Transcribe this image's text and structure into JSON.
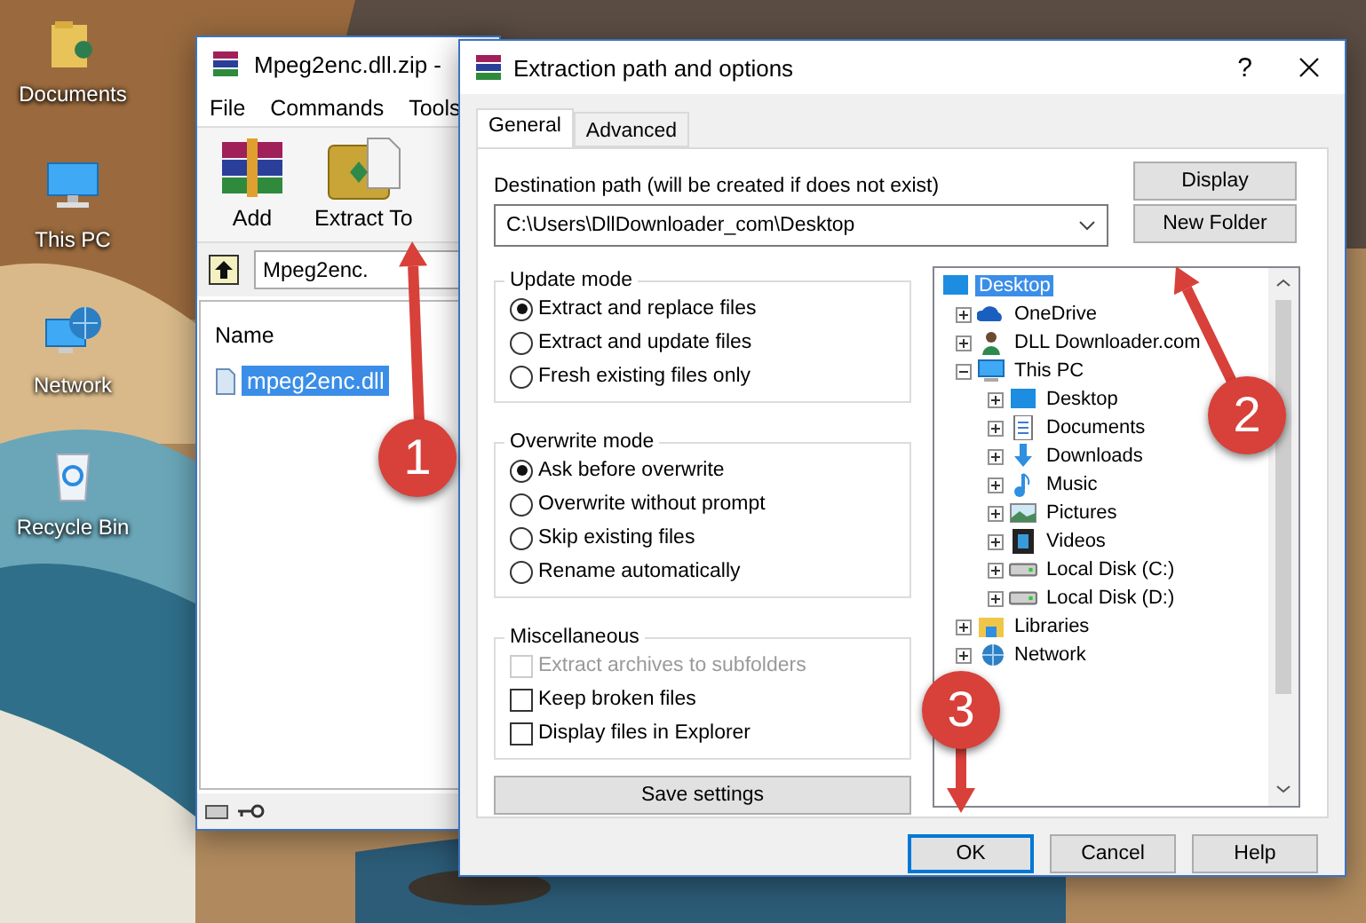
{
  "desktop_icons": [
    {
      "label": "Documents",
      "kind": "folder"
    },
    {
      "label": "This PC",
      "kind": "computer"
    },
    {
      "label": "Network",
      "kind": "network"
    },
    {
      "label": "Recycle Bin",
      "kind": "bin"
    }
  ],
  "archiver": {
    "title": "Mpeg2enc.dll.zip -",
    "menu": [
      "File",
      "Commands",
      "Tools"
    ],
    "toolbar": [
      {
        "label": "Add",
        "kind": "add"
      },
      {
        "label": "Extract To",
        "kind": "extract"
      }
    ],
    "path": "Mpeg2enc.",
    "column": "Name",
    "files": [
      {
        "name": "mpeg2enc.dll",
        "selected": true
      }
    ]
  },
  "dialog": {
    "title": "Extraction path and options",
    "help": "?",
    "tabs": [
      {
        "label": "General",
        "selected": true
      },
      {
        "label": "Advanced",
        "selected": false
      }
    ],
    "destination": {
      "label": "Destination path (will be created if does not exist)",
      "value": "C:\\Users\\DllDownloader_com\\Desktop"
    },
    "side_buttons": [
      "Display",
      "New Folder"
    ],
    "groups": [
      {
        "title": "Update mode",
        "kind": "radio",
        "options": [
          {
            "label": "Extract and replace files",
            "selected": true
          },
          {
            "label": "Extract and update files",
            "selected": false
          },
          {
            "label": "Fresh existing files only",
            "selected": false
          }
        ]
      },
      {
        "title": "Overwrite mode",
        "kind": "radio",
        "options": [
          {
            "label": "Ask before overwrite",
            "selected": true
          },
          {
            "label": "Overwrite without prompt",
            "selected": false
          },
          {
            "label": "Skip existing files",
            "selected": false
          },
          {
            "label": "Rename automatically",
            "selected": false
          }
        ]
      },
      {
        "title": "Miscellaneous",
        "kind": "check",
        "options": [
          {
            "label": "Extract archives to subfolders",
            "checked": false,
            "disabled": true
          },
          {
            "label": "Keep broken files",
            "checked": false,
            "disabled": false
          },
          {
            "label": "Display files in Explorer",
            "checked": false,
            "disabled": false
          }
        ]
      }
    ],
    "save_button": "Save settings",
    "tree": [
      {
        "label": "Desktop",
        "kind": "desktop",
        "selected": true,
        "children": [
          {
            "label": "OneDrive",
            "kind": "cloud",
            "selected": false,
            "expanded": false
          },
          {
            "label": "DLL Downloader.com",
            "kind": "user",
            "selected": false,
            "expanded": false
          },
          {
            "label": "This PC",
            "kind": "computer",
            "selected": false,
            "expanded": true,
            "children": [
              {
                "label": "Desktop",
                "kind": "desktop",
                "selected": false,
                "expanded": false
              },
              {
                "label": "Documents",
                "kind": "document",
                "selected": false,
                "expanded": false
              },
              {
                "label": "Downloads",
                "kind": "download",
                "selected": false,
                "expanded": false
              },
              {
                "label": "Music",
                "kind": "music",
                "selected": false,
                "expanded": false
              },
              {
                "label": "Pictures",
                "kind": "pictures",
                "selected": false,
                "expanded": false
              },
              {
                "label": "Videos",
                "kind": "video",
                "selected": false,
                "expanded": false
              },
              {
                "label": "Local Disk (C:)",
                "kind": "disk",
                "selected": false,
                "expanded": false
              },
              {
                "label": "Local Disk (D:)",
                "kind": "disk",
                "selected": false,
                "expanded": false
              }
            ]
          },
          {
            "label": "Libraries",
            "kind": "folder",
            "selected": false,
            "expanded": false
          },
          {
            "label": "Network",
            "kind": "network",
            "selected": false,
            "expanded": false
          }
        ]
      }
    ],
    "buttons": [
      {
        "label": "OK",
        "default": true
      },
      {
        "label": "Cancel",
        "default": false
      },
      {
        "label": "Help",
        "default": false
      }
    ]
  },
  "annotations": [
    {
      "number": "1"
    },
    {
      "number": "2"
    },
    {
      "number": "3"
    }
  ]
}
